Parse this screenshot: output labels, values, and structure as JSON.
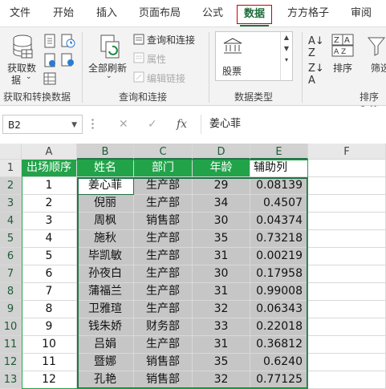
{
  "menu": [
    "文件",
    "开始",
    "插入",
    "页面布局",
    "公式",
    "数据",
    "方方格子",
    "审阅"
  ],
  "active_menu": "数据",
  "ribbon": {
    "get_data_label": "获取数\n据",
    "get_data_line1": "获取数",
    "get_data_line2": "据",
    "group1_label": "获取和转换数据",
    "refresh_all": "全部刷新",
    "query_connect": "查询和连接",
    "properties": "属性",
    "edit_links": "编辑链接",
    "group2_label": "查询和连接",
    "stock": "股票",
    "group3_label": "数据类型",
    "sort": "排序",
    "filter": "筛选",
    "group4_label": "排序和筛"
  },
  "formula_bar": {
    "name_box": "B2",
    "cancel": "✕",
    "enter": "✓",
    "fx": "fx",
    "content": "姜心菲"
  },
  "columns": [
    "A",
    "B",
    "C",
    "D",
    "E",
    "F"
  ],
  "rows": [
    "1",
    "2",
    "3",
    "4",
    "5",
    "6",
    "7",
    "8",
    "9",
    "10",
    "11",
    "12",
    "13"
  ],
  "headers": [
    "出场顺序",
    "姓名",
    "部门",
    "年龄",
    "辅助列"
  ],
  "table": [
    {
      "order": "1",
      "name": "姜心菲",
      "dept": "生产部",
      "age": "29",
      "aux": "0.08139"
    },
    {
      "order": "2",
      "name": "倪丽",
      "dept": "生产部",
      "age": "34",
      "aux": "0.4507"
    },
    {
      "order": "3",
      "name": "周枫",
      "dept": "销售部",
      "age": "30",
      "aux": "0.04374"
    },
    {
      "order": "4",
      "name": "施秋",
      "dept": "生产部",
      "age": "35",
      "aux": "0.73218"
    },
    {
      "order": "5",
      "name": "毕凯敏",
      "dept": "生产部",
      "age": "31",
      "aux": "0.00219"
    },
    {
      "order": "6",
      "name": "孙夜白",
      "dept": "生产部",
      "age": "30",
      "aux": "0.17958"
    },
    {
      "order": "7",
      "name": "蒲福兰",
      "dept": "生产部",
      "age": "31",
      "aux": "0.99008"
    },
    {
      "order": "8",
      "name": "卫雅瑄",
      "dept": "生产部",
      "age": "32",
      "aux": "0.06343"
    },
    {
      "order": "9",
      "name": "钱朱娇",
      "dept": "财务部",
      "age": "33",
      "aux": "0.22018"
    },
    {
      "order": "10",
      "name": "吕娟",
      "dept": "生产部",
      "age": "31",
      "aux": "0.36812"
    },
    {
      "order": "11",
      "name": "暨娜",
      "dept": "销售部",
      "age": "35",
      "aux": "0.6240"
    },
    {
      "order": "12",
      "name": "孔艳",
      "dept": "销售部",
      "age": "32",
      "aux": "0.77125"
    }
  ],
  "colors": {
    "accent": "#217346",
    "header_fill": "#22a34a",
    "selection_fill": "#c6c6c6"
  }
}
